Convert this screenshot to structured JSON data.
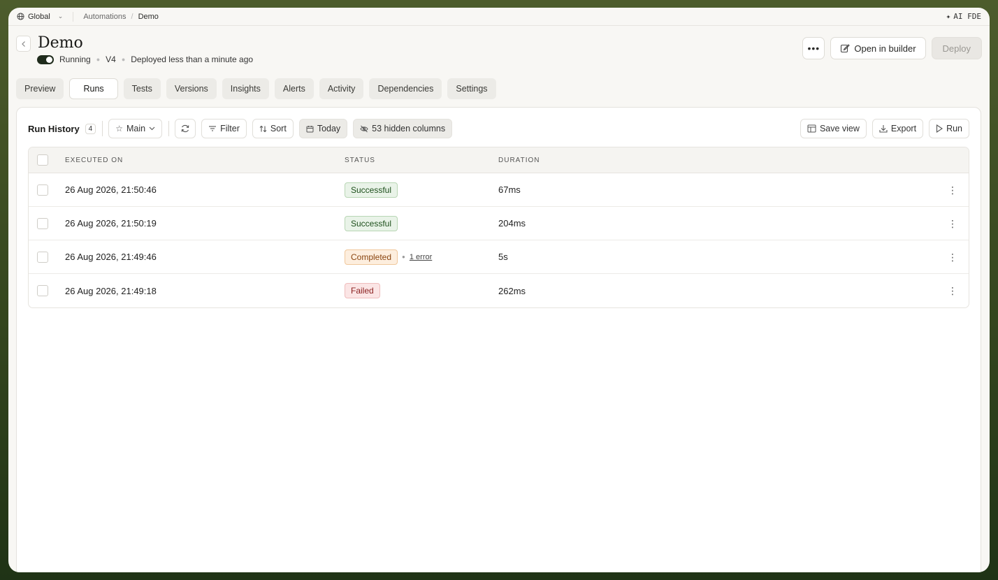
{
  "topbar": {
    "workspace": "Global",
    "breadcrumbs": [
      "Automations",
      "Demo"
    ],
    "ai_label": "AI FDE"
  },
  "header": {
    "title": "Demo",
    "status": "Running",
    "version": "V4",
    "deployed": "Deployed less than a minute ago",
    "open_builder_label": "Open in builder",
    "deploy_label": "Deploy"
  },
  "tabs": [
    {
      "label": "Preview"
    },
    {
      "label": "Runs"
    },
    {
      "label": "Tests"
    },
    {
      "label": "Versions"
    },
    {
      "label": "Insights"
    },
    {
      "label": "Alerts"
    },
    {
      "label": "Activity"
    },
    {
      "label": "Dependencies"
    },
    {
      "label": "Settings"
    }
  ],
  "toolbar": {
    "title": "Run History",
    "count": "4",
    "view": "Main",
    "filter": "Filter",
    "sort": "Sort",
    "date": "Today",
    "hidden_columns": "53 hidden columns",
    "save_view": "Save view",
    "export": "Export",
    "run": "Run"
  },
  "table": {
    "columns": [
      "EXECUTED ON",
      "STATUS",
      "DURATION"
    ],
    "rows": [
      {
        "executed_on": "26 Aug 2026, 21:50:46",
        "status": "Successful",
        "duration": "67ms"
      },
      {
        "executed_on": "26 Aug 2026, 21:50:19",
        "status": "Successful",
        "duration": "204ms"
      },
      {
        "executed_on": "26 Aug 2026, 21:49:46",
        "status": "Completed",
        "error": "1 error",
        "duration": "5s"
      },
      {
        "executed_on": "26 Aug 2026, 21:49:18",
        "status": "Failed",
        "duration": "262ms"
      }
    ]
  },
  "colors": {
    "success": "#1d4f1b",
    "warning": "#8a4510",
    "failure": "#8a1f1f"
  }
}
